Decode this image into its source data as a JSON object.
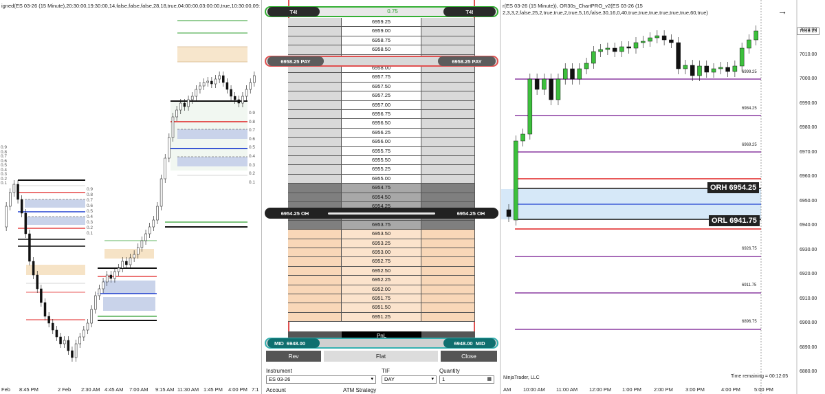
{
  "left_chart": {
    "title": "igned(ES 03-26 (15 Minute),20:30:00,19:30:00,14,false,false,false,28,18,true,04:00:00,03:00:00,true,10:30:00,09:30:00,true,true,true,tr",
    "x_labels": [
      "Feb",
      "8:45 PM",
      "2 Feb",
      "2:30 AM",
      "4:45 AM",
      "7:00 AM",
      "9:15 AM",
      "11:30 AM",
      "1:45 PM",
      "4:00 PM",
      "7:1"
    ],
    "fib_top": [
      "0.9",
      "0.8",
      "0.7",
      "0.6",
      "0.5",
      "0.4",
      "0.3",
      "0.2",
      "0.1"
    ],
    "fib_left": [
      "0.9",
      "0.8",
      "0.7",
      "0.6",
      "0.5",
      "0.4",
      "0.3",
      "0.2",
      "0.1"
    ],
    "fib_mid": [
      "0.9",
      "0.8",
      "0.7",
      "0.6",
      "0.5",
      "0.4",
      "0.3",
      "0.2",
      "0.1"
    ]
  },
  "dom": {
    "top_left_pill": "T4!",
    "top_right_pill": "T4!",
    "top_center_value": "0.75",
    "pay_left": "6958.25 PAY",
    "pay_right": "6958.25 PAY",
    "oh_left": "6954.25 OH",
    "oh_right": "6954.25 OH",
    "mid_left_label": "MID",
    "mid_left_value": "6948.00",
    "mid_right_value": "6948.00",
    "mid_right_label": "MID",
    "pnl_header": "PnL",
    "prices": [
      "6959.25",
      "6959.00",
      "6958.75",
      "6958.50",
      "6958.25",
      "6958.00",
      "6957.75",
      "6957.50",
      "6957.25",
      "6957.00",
      "6956.75",
      "6956.50",
      "6956.25",
      "6956.00",
      "6955.75",
      "6955.50",
      "6955.25",
      "6955.00",
      "6954.75",
      "6954.50",
      "6954.25",
      "6954.00",
      "6953.75",
      "6953.50",
      "6953.25",
      "6953.00",
      "6952.75",
      "6952.50",
      "6952.25",
      "6952.00",
      "6951.75",
      "6951.50",
      "6951.25"
    ],
    "rev_label": "Rev",
    "flat_label": "Flat",
    "close_label": "Close",
    "instrument_label": "Instrument",
    "instrument_value": "ES 03-26",
    "tif_label": "TIF",
    "tif_value": "DAY",
    "quantity_label": "Quantity",
    "quantity_value": "1",
    "account_label": "Account",
    "atm_label": "ATM Strategy"
  },
  "right_chart": {
    "title_line1": "r(ES 03-26 (15 Minute)), OR30s_ChartPRO_v2(ES 03-26 (15",
    "title_line2": "2,3,3,2,false,25,2,true,true,2,true,5,16,false,30,16,0,40,true,true,true,true,true,true,60,true)",
    "arrow_icon": "→",
    "price_labels": [
      "7020.00",
      "7010.00",
      "7000.00",
      "6990.00",
      "6980.00",
      "6970.00",
      "6960.00",
      "6950.00",
      "6940.00",
      "6930.00",
      "6920.00",
      "6910.00",
      "6900.00",
      "6890.00",
      "6880.00"
    ],
    "current_price": "7018.25",
    "orh_label": "ORH 6954.25",
    "orl_label": "ORL 6941.75",
    "level_labels": [
      "6999.25",
      "6984.25",
      "6969.25",
      "6926.75",
      "6911.75",
      "6896.75"
    ],
    "x_labels": [
      "AM",
      "10:00 AM",
      "11:00 AM",
      "12:00 PM",
      "1:00 PM",
      "2:00 PM",
      "3:00 PM",
      "4:00 PM",
      "5:00 PM"
    ],
    "footer_brand": "NinjaTrader, LLC",
    "time_remaining": "Time remaining = 00:12:05"
  }
}
